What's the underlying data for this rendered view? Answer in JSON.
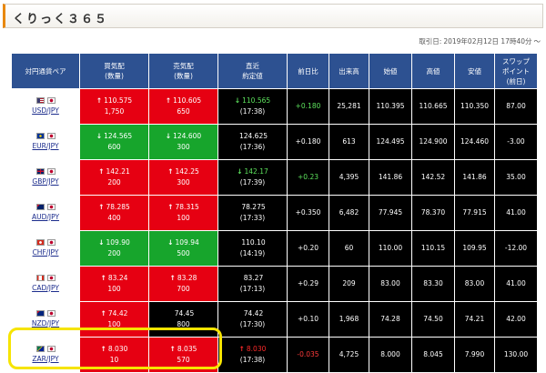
{
  "header": {
    "title": "くりっく３６５"
  },
  "timestamp": {
    "label": "取引日:",
    "value": "2019年02月12日 17時40分",
    "suffix": "〜"
  },
  "columns": [
    "対円通貨ペア",
    "買気配\n(数量)",
    "売気配\n(数量)",
    "直近\n約定値",
    "前日比",
    "出来高",
    "始値",
    "高値",
    "安値",
    "スワップ\nポイント\n(前日)"
  ],
  "rows": [
    {
      "pair": "USD/JPY",
      "flag": "us",
      "buy": "110.575",
      "buy_qty": "1,750",
      "buy_arrow": "↑",
      "buy_color": "red",
      "sell": "110.605",
      "sell_qty": "650",
      "sell_arrow": "↑",
      "sell_color": "red",
      "last": "110.565",
      "last_time": "(17:38)",
      "last_arrow": "↓",
      "last_dir": "dn",
      "change": "+0.180",
      "change_dir": "pos",
      "volume": "25,281",
      "open": "110.395",
      "high": "110.665",
      "low": "110.350",
      "swap": "87.00"
    },
    {
      "pair": "EUR/JPY",
      "flag": "eu",
      "buy": "124.565",
      "buy_qty": "600",
      "buy_arrow": "↓",
      "buy_color": "green",
      "sell": "124.600",
      "sell_qty": "300",
      "sell_arrow": "↓",
      "sell_color": "green",
      "last": "124.625",
      "last_time": "(17:36)",
      "last_arrow": "",
      "last_dir": "",
      "change": "+0.180",
      "change_dir": "",
      "volume": "613",
      "open": "124.495",
      "high": "124.900",
      "low": "124.460",
      "swap": "-3.00"
    },
    {
      "pair": "GBP/JPY",
      "flag": "gb",
      "buy": "142.21",
      "buy_qty": "200",
      "buy_arrow": "↑",
      "buy_color": "red",
      "sell": "142.25",
      "sell_qty": "300",
      "sell_arrow": "↑",
      "sell_color": "red",
      "last": "142.17",
      "last_time": "(17:39)",
      "last_arrow": "↓",
      "last_dir": "dn",
      "change": "+0.23",
      "change_dir": "pos",
      "volume": "4,395",
      "open": "141.86",
      "high": "142.52",
      "low": "141.86",
      "swap": "35.00"
    },
    {
      "pair": "AUD/JPY",
      "flag": "au",
      "buy": "78.285",
      "buy_qty": "400",
      "buy_arrow": "↑",
      "buy_color": "red",
      "sell": "78.315",
      "sell_qty": "100",
      "sell_arrow": "↑",
      "sell_color": "red",
      "last": "78.275",
      "last_time": "(17:33)",
      "last_arrow": "",
      "last_dir": "",
      "change": "+0.350",
      "change_dir": "",
      "volume": "6,482",
      "open": "77.945",
      "high": "78.370",
      "low": "77.915",
      "swap": "41.00"
    },
    {
      "pair": "CHF/JPY",
      "flag": "ch",
      "buy": "109.90",
      "buy_qty": "200",
      "buy_arrow": "↓",
      "buy_color": "green",
      "sell": "109.94",
      "sell_qty": "500",
      "sell_arrow": "↓",
      "sell_color": "green",
      "last": "110.10",
      "last_time": "(14:19)",
      "last_arrow": "",
      "last_dir": "",
      "change": "+0.20",
      "change_dir": "",
      "volume": "60",
      "open": "110.00",
      "high": "110.15",
      "low": "109.95",
      "swap": "-12.00"
    },
    {
      "pair": "CAD/JPY",
      "flag": "ca",
      "buy": "83.24",
      "buy_qty": "100",
      "buy_arrow": "↑",
      "buy_color": "red",
      "sell": "83.28",
      "sell_qty": "700",
      "sell_arrow": "↑",
      "sell_color": "red",
      "last": "83.27",
      "last_time": "(17:13)",
      "last_arrow": "",
      "last_dir": "",
      "change": "+0.29",
      "change_dir": "",
      "volume": "209",
      "open": "83.00",
      "high": "83.30",
      "low": "83.00",
      "swap": "41.00"
    },
    {
      "pair": "NZD/JPY",
      "flag": "nz",
      "buy": "74.42",
      "buy_qty": "100",
      "buy_arrow": "↑",
      "buy_color": "red",
      "sell": "74.45",
      "sell_qty": "800",
      "sell_arrow": "",
      "sell_color": "",
      "last": "74.42",
      "last_time": "(17:30)",
      "last_arrow": "",
      "last_dir": "",
      "change": "+0.10",
      "change_dir": "",
      "volume": "1,968",
      "open": "74.28",
      "high": "74.50",
      "low": "74.21",
      "swap": "42.00"
    },
    {
      "pair": "ZAR/JPY",
      "flag": "za",
      "buy": "8.030",
      "buy_qty": "10",
      "buy_arrow": "↑",
      "buy_color": "red",
      "sell": "8.035",
      "sell_qty": "570",
      "sell_arrow": "↑",
      "sell_color": "red",
      "last": "8.030",
      "last_time": "(17:38)",
      "last_arrow": "↑",
      "last_dir": "up",
      "change": "-0.035",
      "change_dir": "neg",
      "volume": "4,725",
      "open": "8.000",
      "high": "8.045",
      "low": "7.990",
      "swap": "130.00"
    }
  ],
  "colors": {
    "header_bg": "#2d5191",
    "cell_bg": "#000000",
    "bid_up": "#e60012",
    "bid_down": "#17a52c",
    "highlight": "#f6e400",
    "accent": "#e8880f"
  }
}
